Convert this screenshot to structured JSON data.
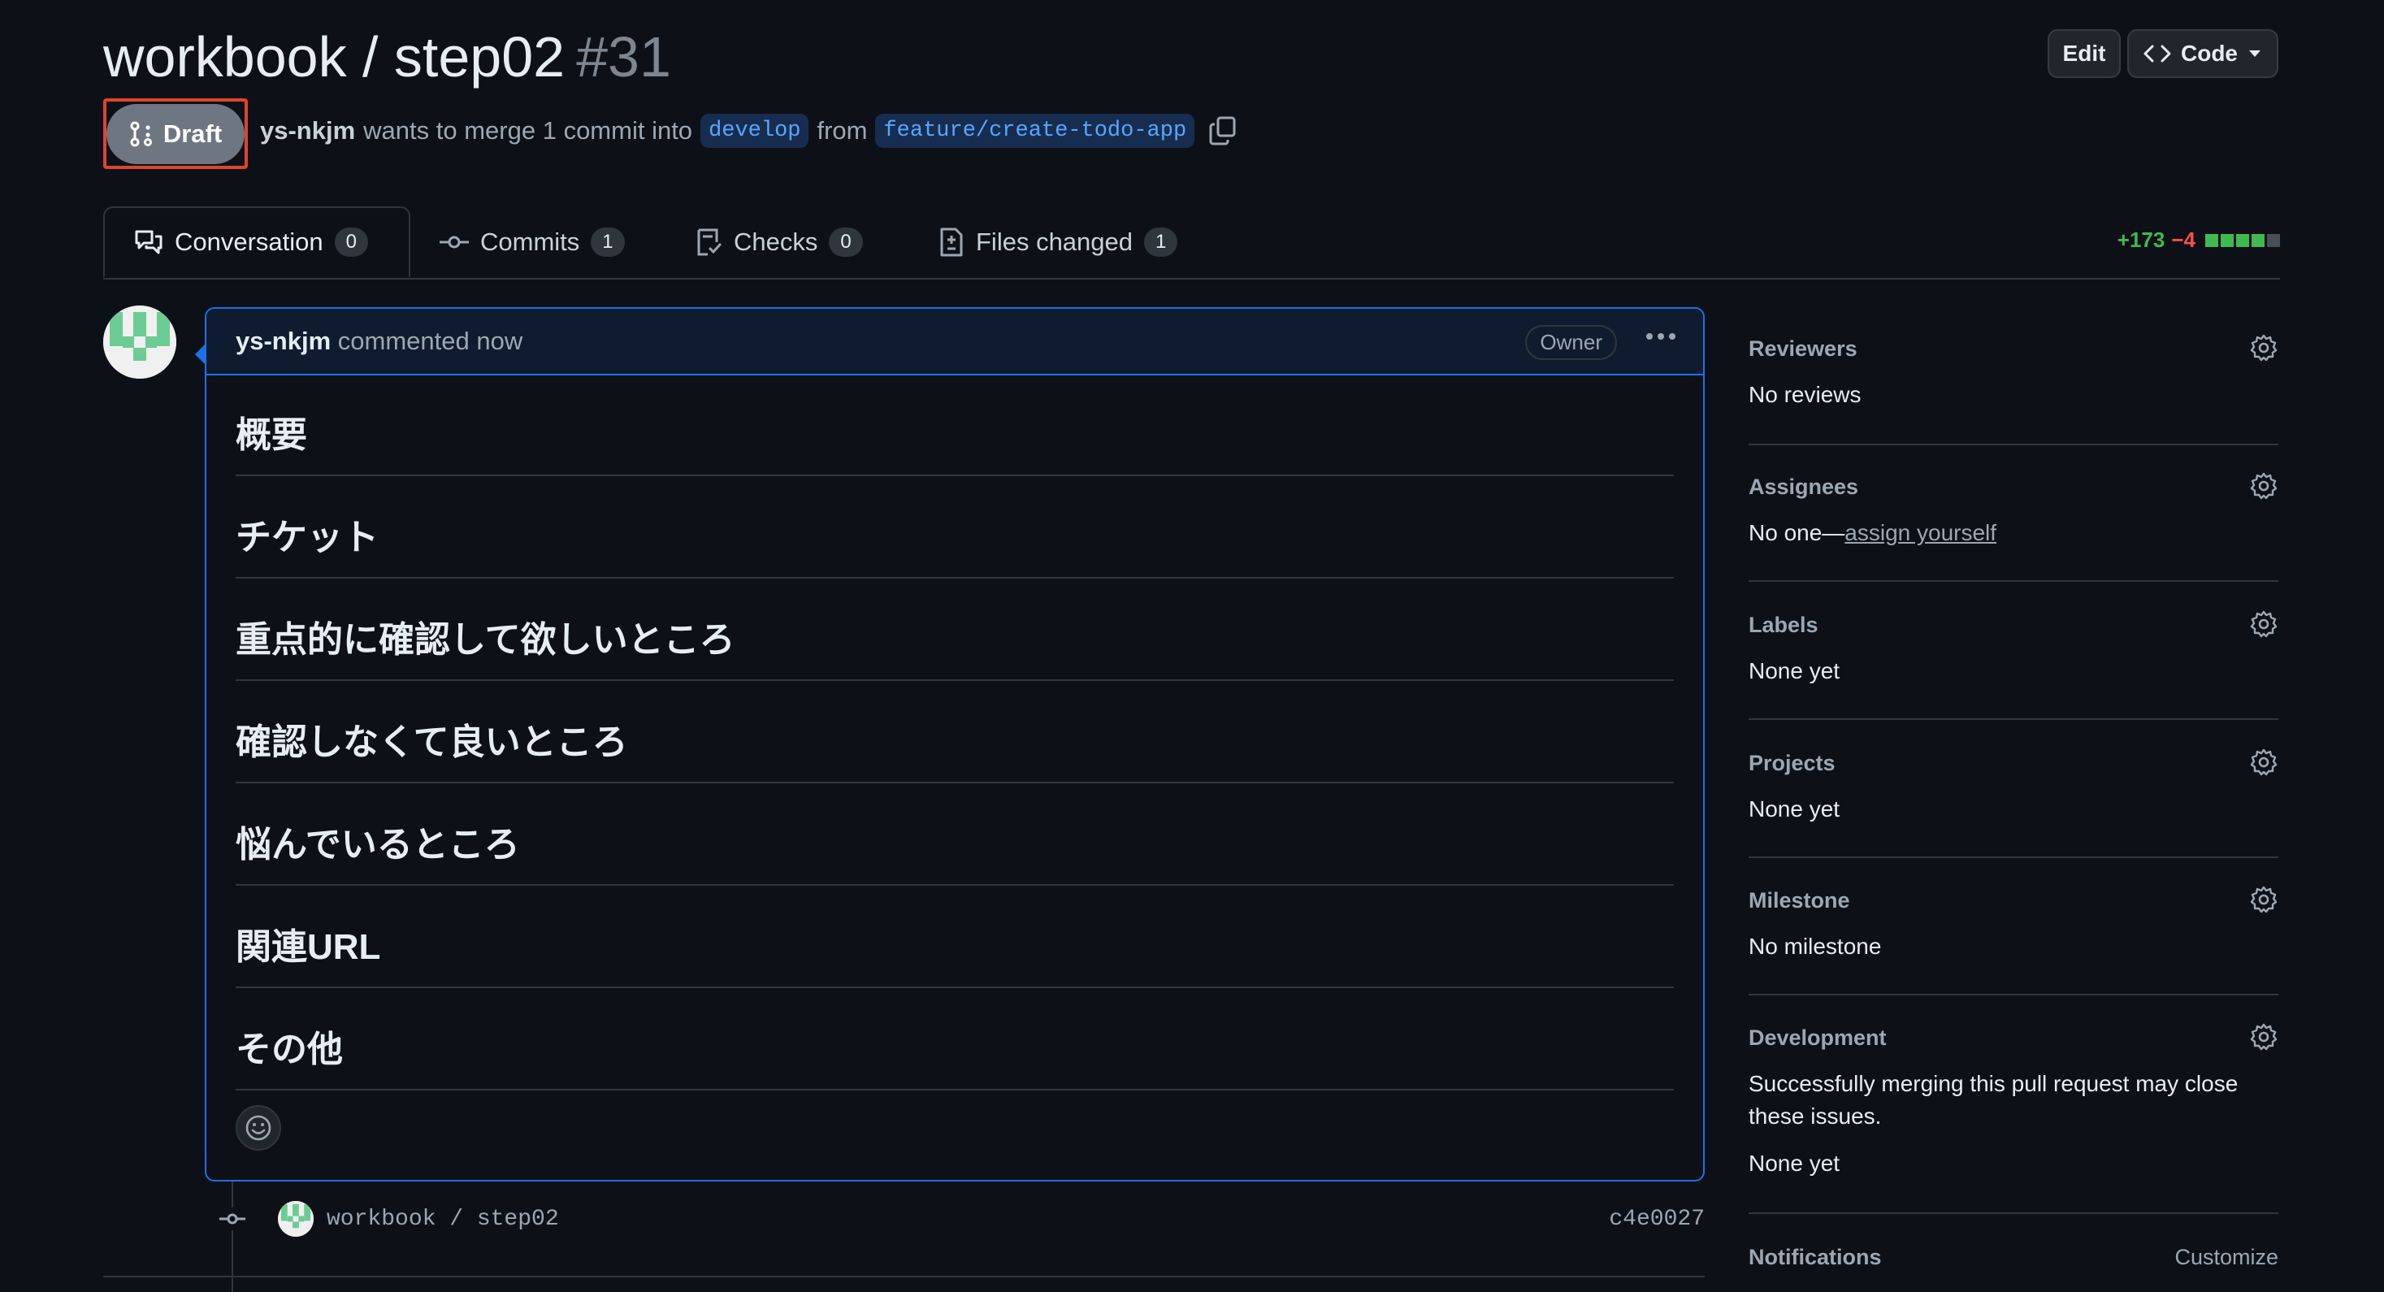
{
  "pr": {
    "repo_title": "workbook / step02",
    "number": "#31",
    "state_badge": "Draft",
    "author": "ys-nkjm",
    "meta_text": "wants to merge 1 commit into",
    "base_branch": "develop",
    "from_text": "from",
    "head_branch": "feature/create-todo-app"
  },
  "header_buttons": {
    "edit": "Edit",
    "code": "Code"
  },
  "tabs": [
    {
      "label": "Conversation",
      "count": "0",
      "icon": "comment-discussion-icon"
    },
    {
      "label": "Commits",
      "count": "1",
      "icon": "git-commit-icon"
    },
    {
      "label": "Checks",
      "count": "0",
      "icon": "checklist-icon"
    },
    {
      "label": "Files changed",
      "count": "1",
      "icon": "file-diff-icon"
    }
  ],
  "diffstat": {
    "additions": "+173",
    "deletions": "−4",
    "blocks": [
      "add",
      "add",
      "add",
      "add",
      "neutral"
    ]
  },
  "comment": {
    "author": "ys-nkjm",
    "action": "commented now",
    "role_badge": "Owner",
    "sections": [
      "概要",
      "チケット",
      "重点的に確認して欲しいところ",
      "確認しなくて良いところ",
      "悩んでいるところ",
      "関連URL",
      "その他"
    ]
  },
  "commit": {
    "message": "workbook / step02",
    "sha": "c4e0027"
  },
  "sidebar": {
    "reviewers": {
      "label": "Reviewers",
      "value": "No reviews"
    },
    "assignees": {
      "label": "Assignees",
      "value_prefix": "No one—",
      "link": "assign yourself"
    },
    "labels": {
      "label": "Labels",
      "value": "None yet"
    },
    "projects": {
      "label": "Projects",
      "value": "None yet"
    },
    "milestone": {
      "label": "Milestone",
      "value": "No milestone"
    },
    "development": {
      "label": "Development",
      "text": "Successfully merging this pull request may close these issues.",
      "value": "None yet"
    },
    "notifications": {
      "label": "Notifications",
      "action": "Customize"
    }
  },
  "colors": {
    "background": "#0d1117",
    "accent": "#1f6feb",
    "link": "#58a6ff",
    "draft": "#6e7681",
    "additions": "#3fb950",
    "deletions": "#f85149",
    "highlight": "#e0442b"
  }
}
